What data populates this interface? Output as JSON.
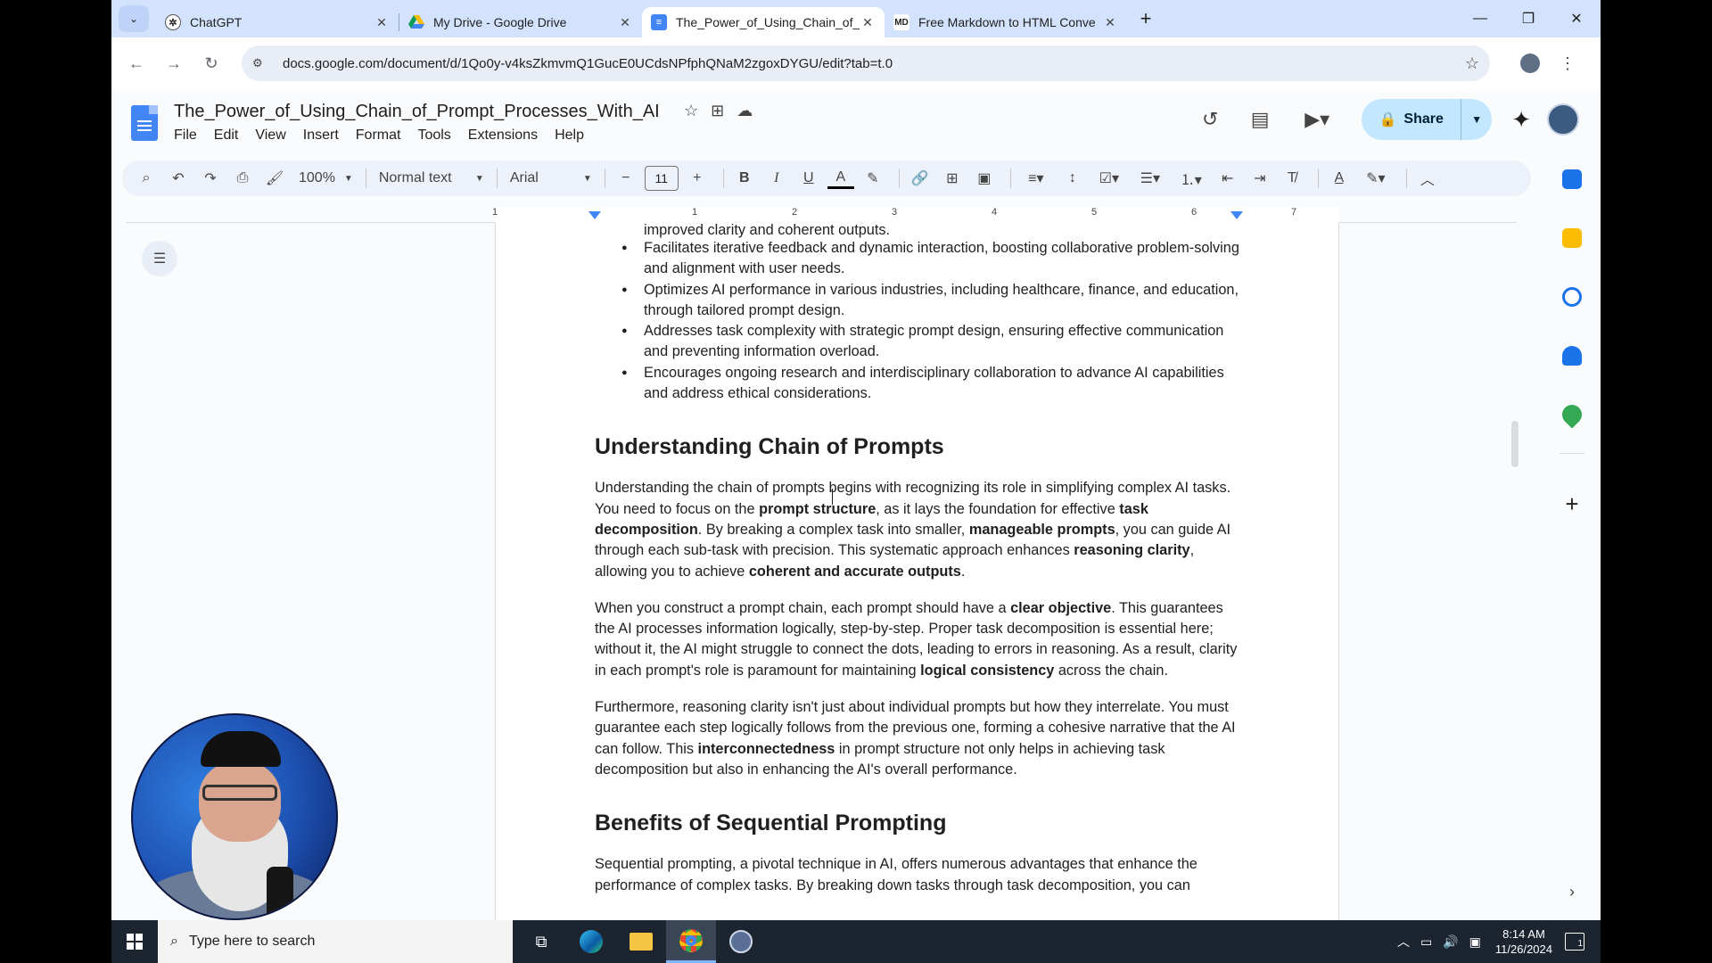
{
  "browser": {
    "tabs": [
      {
        "label": "ChatGPT",
        "favicon": "chatgpt-icon",
        "favcolor": "#1f1f1f",
        "active": false
      },
      {
        "label": "My Drive - Google Drive",
        "favicon": "google-drive-icon",
        "favcolor": "#fbbc04",
        "active": false
      },
      {
        "label": "The_Power_of_Using_Chain_of_I",
        "favicon": "google-docs-icon",
        "favcolor": "#4285f4",
        "active": true
      },
      {
        "label": "Free Markdown to HTML Conve",
        "favicon": "md-icon",
        "favcolor": "#333333",
        "active": false
      }
    ],
    "tab_close": "✕",
    "newtab": "+",
    "url": "docs.google.com/document/d/1Qo0y-v4ksZkmvmQ1GucE0UCdsNPfphQNaM2zgoxDYGU/edit?tab=t.0"
  },
  "docs": {
    "title": "The_Power_of_Using_Chain_of_Prompt_Processes_With_AI",
    "menu": [
      "File",
      "Edit",
      "View",
      "Insert",
      "Format",
      "Tools",
      "Extensions",
      "Help"
    ],
    "share_label": "Share",
    "toolbar": {
      "zoom": "100%",
      "style": "Normal text",
      "font": "Arial",
      "font_size": "11"
    },
    "ruler_numbers": [
      "1",
      "1",
      "2",
      "3",
      "4",
      "5",
      "6",
      "7"
    ]
  },
  "document": {
    "top_partial": "improved clarity and coherent outputs.",
    "bullets": [
      "Facilitates iterative feedback and dynamic interaction, boosting collaborative problem-solving and alignment with user needs.",
      "Optimizes AI performance in various industries, including healthcare, finance, and education, through tailored prompt design.",
      "Addresses task complexity with strategic prompt design, ensuring effective communication and preventing information overload.",
      "Encourages ongoing research and interdisciplinary collaboration to advance AI capabilities and address ethical considerations."
    ],
    "h1": "Understanding Chain of Prompts",
    "p1": {
      "a": "Understanding the chain of prompts begins with recognizing its role in simplifying complex AI tasks. You need to focus on the ",
      "b1": "prompt structure",
      "c": ", as it lays the foundation for effective ",
      "b2": "task decomposition",
      "d": ". By breaking a complex task into smaller, ",
      "b3": "manageable prompts",
      "e": ", you can guide AI through each sub-task with precision. This systematic approach enhances ",
      "b4": "reasoning clarity",
      "f": ", allowing you to achieve ",
      "b5": "coherent and accurate outputs",
      "g": "."
    },
    "p2": {
      "a": "When you construct a prompt chain, each prompt should have a ",
      "b1": "clear objective",
      "c": ". This guarantees the AI processes information logically, step-by-step. Proper task decomposition is essential here; without it, the AI might struggle to connect the dots, leading to errors in reasoning. As a result, clarity in each prompt's role is paramount for maintaining ",
      "b2": "logical consistency",
      "d": " across the chain."
    },
    "p3": {
      "a": "Furthermore, reasoning clarity isn't just about individual prompts but how they interrelate. You must guarantee each step logically follows from the previous one, forming a cohesive narrative that the AI can follow. This ",
      "b1": "interconnectedness",
      "c": " in prompt structure not only helps in achieving task decomposition but also in enhancing the AI's overall performance."
    },
    "h2": "Benefits of Sequential Prompting",
    "p4": "Sequential prompting, a pivotal technique in AI, offers numerous advantages that enhance the performance of complex tasks. By breaking down tasks through task decomposition, you can"
  },
  "taskbar": {
    "search_placeholder": "Type here to search",
    "time": "8:14 AM",
    "date": "11/26/2024",
    "notif_count": "1"
  },
  "colors": {
    "tabstrip": "#d3e3fd",
    "share_bg": "#c2e7ff",
    "docs_blue": "#4285f4",
    "taskbar": "#1c2430"
  }
}
